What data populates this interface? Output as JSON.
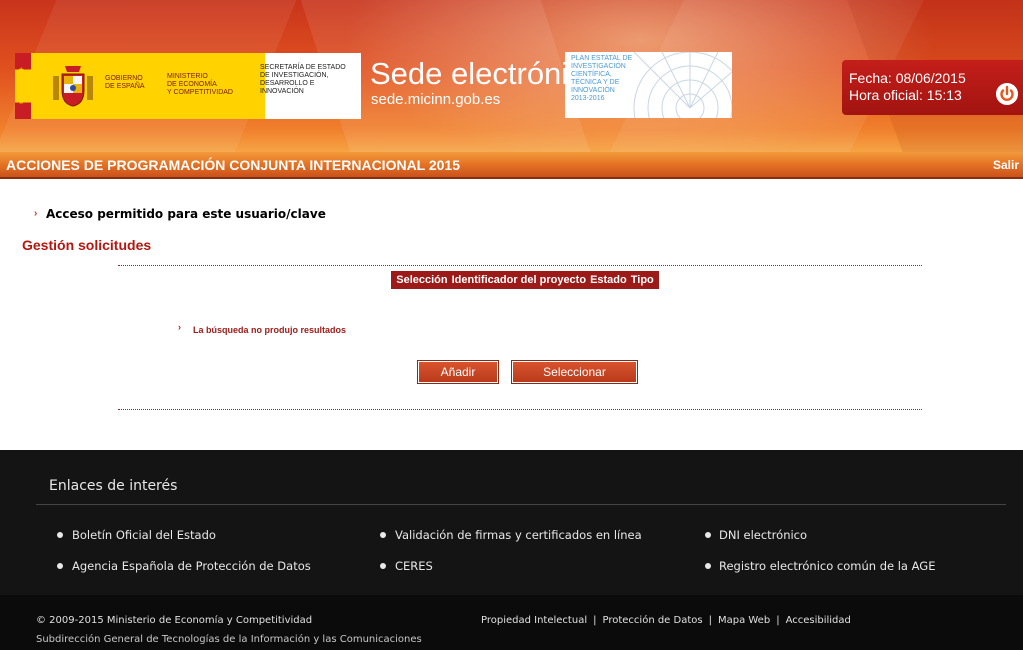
{
  "header": {
    "gov_spain": [
      "GOBIERNO",
      "DE ESPAÑA"
    ],
    "ministry": [
      "MINISTERIO",
      "DE ECONOMÍA",
      "Y COMPETITIVIDAD"
    ],
    "secretariat": [
      "SECRETARÍA DE ESTADO",
      "DE INVESTIGACIÓN,",
      "DESARROLLO E",
      "INNOVACIÓN"
    ],
    "sede_title": "Sede electrónica",
    "sede_url": "sede.micinn.gob.es",
    "plan": [
      "PLAN ESTATAL DE",
      "INVESTIGACIÓN",
      "CIENTÍFICA,",
      "TÉCNICA Y DE",
      "INNOVACIÓN",
      "2013-2016"
    ],
    "date": "Fecha: 08/06/2015",
    "time": "Hora oficial: 15:13",
    "program_title": "ACCIONES DE PROGRAMACIÓN CONJUNTA INTERNACIONAL 2015",
    "logout": "Salir"
  },
  "main": {
    "access_message": "Acceso permitido para este usuario/clave",
    "section_title": "Gestión solicitudes",
    "table_columns": [
      "Selección",
      "Identificador del proyecto",
      "Estado",
      "Tipo"
    ],
    "no_results": "La búsqueda no produjo resultados",
    "add_button": "Añadir",
    "select_button": "Seleccionar"
  },
  "footer": {
    "heading": "Enlaces de interés",
    "links": [
      "Boletín Oficial del Estado",
      "Validación de firmas y certificados en línea",
      "DNI electrónico",
      "Agencia Española de Protección de Datos",
      "CERES",
      "Registro electrónico común de la AGE"
    ],
    "copyright": "© 2009-2015 Ministerio de Economía y Competitividad",
    "subdirectorate": "Subdirección General de Tecnologías de la Información y las Comunicaciones",
    "legal_links": [
      "Propiedad Intelectual",
      "Protección de Datos",
      "Mapa Web",
      "Accesibilidad"
    ]
  },
  "colors": {
    "brand_red": "#9c1b18",
    "header_orange": "#e0501f",
    "footer_bg": "#141414"
  },
  "icons": [
    "spain-coat-of-arms-icon",
    "plan-estatal-logo-icon",
    "power-icon",
    "arrow-bullet-icon"
  ]
}
